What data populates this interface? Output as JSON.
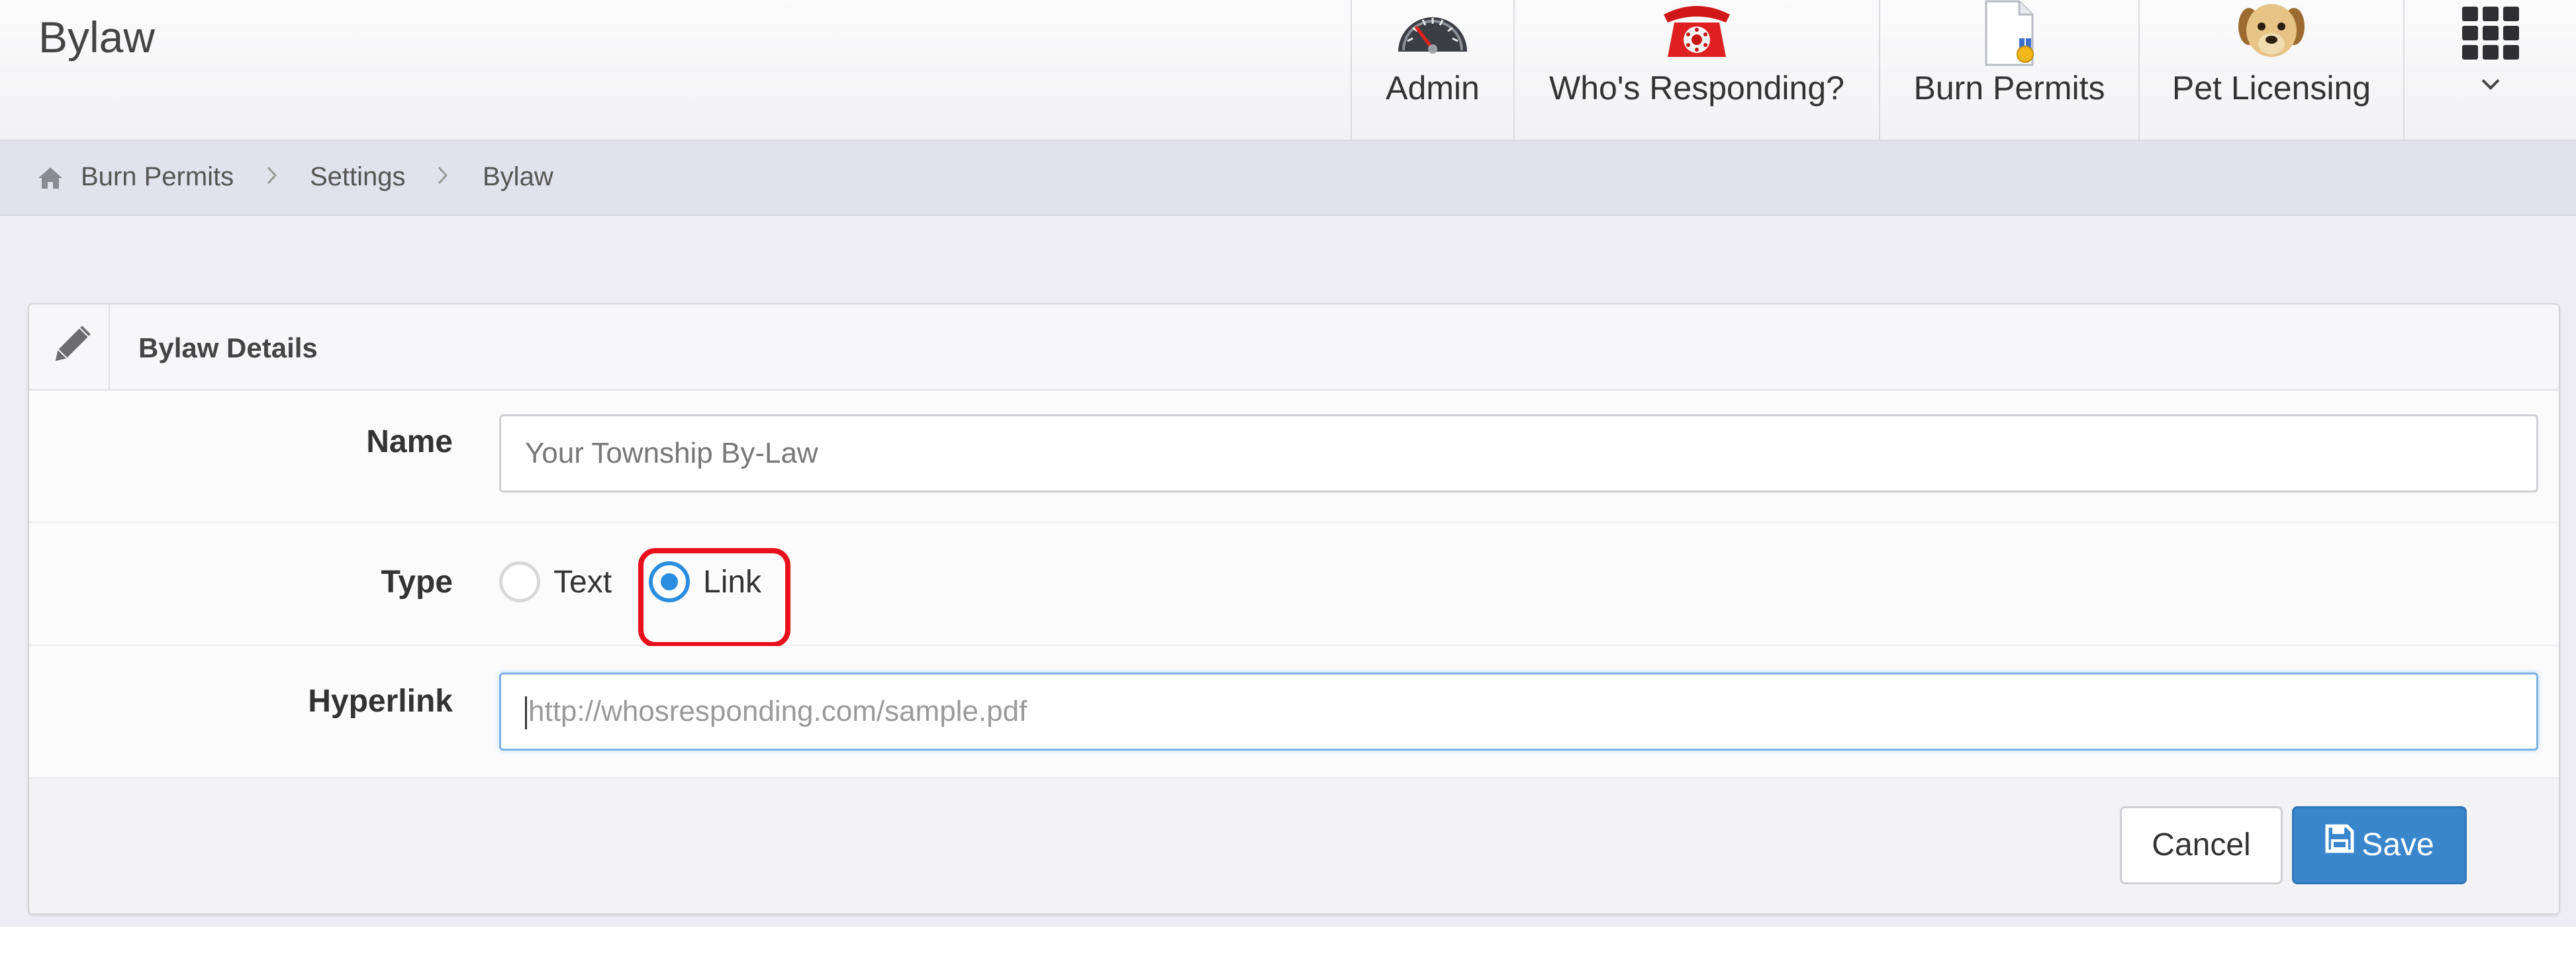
{
  "header": {
    "title": "Bylaw",
    "nav": [
      {
        "label": "Admin",
        "icon": "speedometer-icon"
      },
      {
        "label": "Who's Responding?",
        "icon": "red-telephone-icon"
      },
      {
        "label": "Burn Permits",
        "icon": "permit-document-icon"
      },
      {
        "label": "Pet Licensing",
        "icon": "dog-icon"
      }
    ],
    "apps_menu_icon": "grid-menu-icon"
  },
  "breadcrumb": {
    "home_icon": "home-icon",
    "items": [
      "Burn Permits",
      "Settings",
      "Bylaw"
    ]
  },
  "panel": {
    "title": "Bylaw Details",
    "name": {
      "label": "Name",
      "value": "Your Township By-Law"
    },
    "type": {
      "label": "Type",
      "options": [
        {
          "label": "Text",
          "selected": false
        },
        {
          "label": "Link",
          "selected": true
        }
      ]
    },
    "hyperlink": {
      "label": "Hyperlink",
      "placeholder": "http://whosresponding.com/sample.pdf"
    },
    "buttons": {
      "cancel": "Cancel",
      "save": "Save"
    }
  },
  "colors": {
    "primary": "#3a86cc",
    "radio_selected": "#2a8ee0",
    "highlight": "#e8101a",
    "breadcrumb_bg": "#e2e2ec",
    "page_bg": "#ededf3"
  }
}
